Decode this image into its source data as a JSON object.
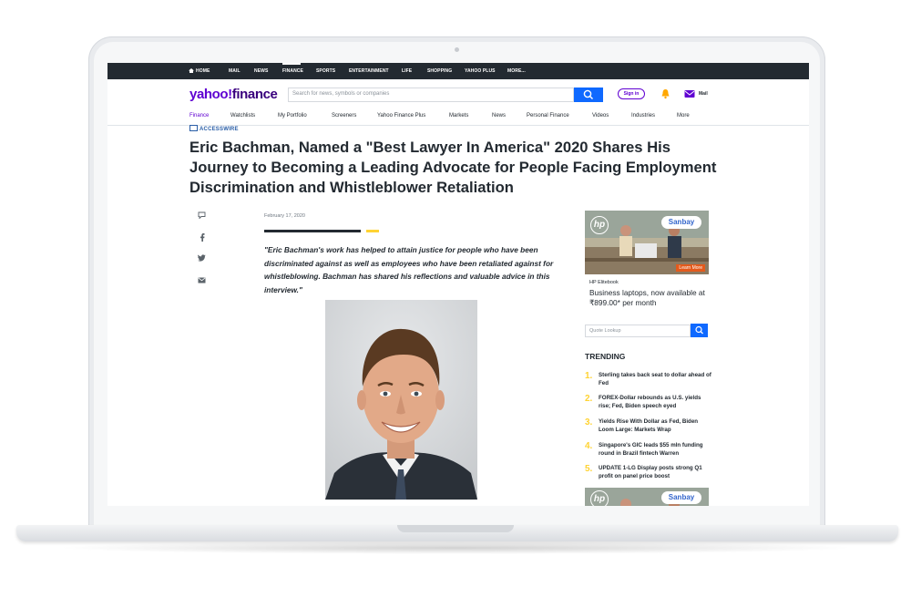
{
  "topnav": {
    "items": [
      "HOME",
      "MAIL",
      "NEWS",
      "FINANCE",
      "SPORTS",
      "ENTERTAINMENT",
      "LIFE",
      "SHOPPING",
      "YAHOO PLUS",
      "MORE..."
    ]
  },
  "header": {
    "logo_yahoo": "yahoo!",
    "logo_finance": "finance",
    "search_placeholder": "Search for news, symbols or companies",
    "signin_label": "Sign in",
    "mail_label": "Mail"
  },
  "subnav": {
    "items": [
      "Finance",
      "Watchlists",
      "My Portfolio",
      "Screeners",
      "Yahoo Finance Plus",
      "Markets",
      "News",
      "Personal Finance",
      "Videos",
      "Industries",
      "More"
    ]
  },
  "article": {
    "provider": "ACCESSWIRE",
    "headline": "Eric Bachman, Named a \"Best Lawyer In America\" 2020 Shares His Journey to Becoming a Leading Advocate for People Facing Employment Discrimination and Whistleblower Retaliation",
    "date": "February 17, 2020",
    "quote": "\"Eric Bachman's work has helped to attain justice for people who have been discriminated against as well as employees who have been retaliated against for whistleblowing. Bachman has shared his reflections and valuable advice in this interview.\""
  },
  "ad": {
    "hp": "hp",
    "brand": "Sanbay",
    "cta": "Learn More",
    "source": "HP Elitebook",
    "title": "Business laptops, now available at ₹899.00* per month"
  },
  "quote_lookup": {
    "placeholder": "Quote Lookup"
  },
  "trending": {
    "heading": "TRENDING",
    "items": [
      {
        "num": "1.",
        "text": "Sterling takes back seat to dollar ahead of Fed"
      },
      {
        "num": "2.",
        "text": "FOREX-Dollar rebounds as U.S. yields rise; Fed, Biden speech eyed"
      },
      {
        "num": "3.",
        "text": "Yields Rise With Dollar as Fed, Biden Loom Large: Markets Wrap"
      },
      {
        "num": "4.",
        "text": "Singapore's GIC leads $55 mln funding round in Brazil fintech Warren"
      },
      {
        "num": "5.",
        "text": "UPDATE 1-LG Display posts strong Q1 profit on panel price boost"
      }
    ]
  },
  "colors": {
    "brand_purple": "#6001d2",
    "search_blue": "#0f69ff",
    "trending_yellow": "#ffd333",
    "topbar": "#232a31"
  }
}
